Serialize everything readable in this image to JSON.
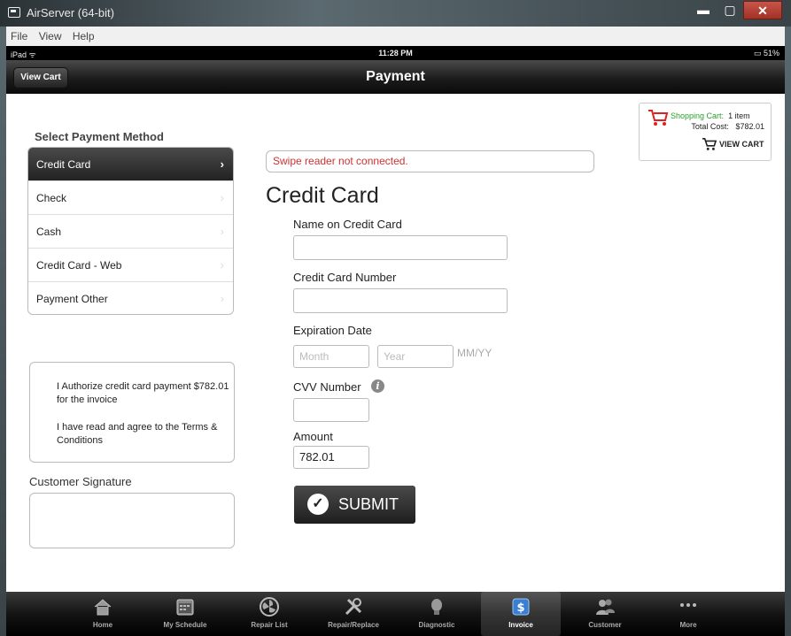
{
  "window": {
    "title": "AirServer (64-bit)",
    "minimize": "▬",
    "maximize": "▢",
    "close": "✕"
  },
  "menu": [
    "File",
    "View",
    "Help"
  ],
  "status": {
    "device": "iPad ᯤ",
    "time": "11:28 PM",
    "battery": "▭ 51%"
  },
  "nav": {
    "view_cart": "View Cart",
    "title": "Payment"
  },
  "cart": {
    "label": "Shopping Cart:",
    "items": "1 item",
    "total_label": "Total Cost:",
    "total": "$782.01",
    "view_cart": "VIEW CART"
  },
  "payment": {
    "section_title": "Select Payment Method",
    "methods": [
      {
        "label": "Credit Card",
        "selected": true
      },
      {
        "label": "Check",
        "selected": false
      },
      {
        "label": "Cash",
        "selected": false
      },
      {
        "label": "Credit Card - Web",
        "selected": false
      },
      {
        "label": "Payment Other",
        "selected": false
      }
    ]
  },
  "auth": {
    "line1": "I Authorize credit card payment $782.01 for the invoice",
    "line2": "I have read and agree to the Terms & Conditions"
  },
  "signature": {
    "label": "Customer Signature"
  },
  "form": {
    "swipe_message": "Swipe reader not connected.",
    "heading": "Credit Card",
    "name_label": "Name on Credit Card",
    "number_label": "Credit Card Number",
    "expiry_label": "Expiration Date",
    "month_placeholder": "Month",
    "year_placeholder": "Year",
    "expiry_format": "MM/YY",
    "cvv_label": "CVV Number",
    "amount_label": "Amount",
    "amount_value": "782.01",
    "submit": "SUBMIT"
  },
  "tabs": [
    {
      "label": "Home",
      "icon": "home-icon",
      "active": false
    },
    {
      "label": "My Schedule",
      "icon": "calendar-icon",
      "active": false
    },
    {
      "label": "Repair List",
      "icon": "fan-icon",
      "active": false
    },
    {
      "label": "Repair/Replace",
      "icon": "tools-icon",
      "active": false
    },
    {
      "label": "Diagnostic",
      "icon": "lightbulb-icon",
      "active": false
    },
    {
      "label": "Invoice",
      "icon": "dollar-icon",
      "active": true
    },
    {
      "label": "Customer",
      "icon": "people-icon",
      "active": false
    },
    {
      "label": "More",
      "icon": "more-dots-icon",
      "active": false
    }
  ],
  "colors": {
    "accent_green": "#2aa02a",
    "error_red": "#cc3333",
    "nav_dark": "#1c1c1c"
  }
}
